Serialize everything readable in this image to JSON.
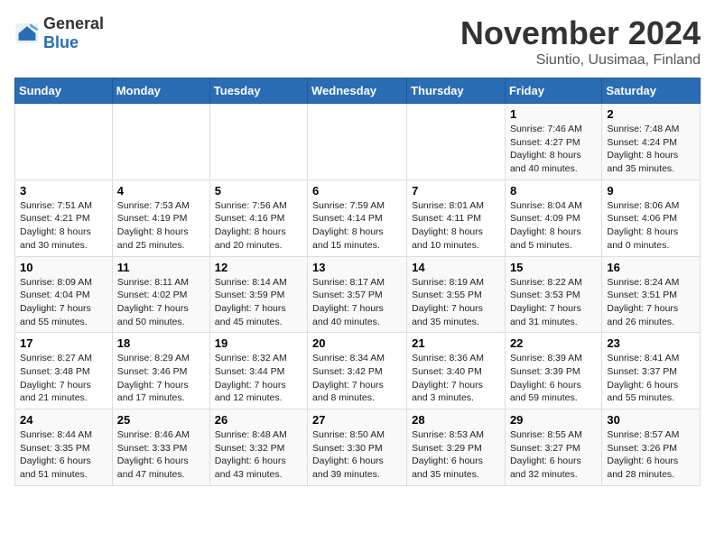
{
  "header": {
    "logo_general": "General",
    "logo_blue": "Blue",
    "month_title": "November 2024",
    "location": "Siuntio, Uusimaa, Finland"
  },
  "weekdays": [
    "Sunday",
    "Monday",
    "Tuesday",
    "Wednesday",
    "Thursday",
    "Friday",
    "Saturday"
  ],
  "weeks": [
    [
      {
        "day": "",
        "info": ""
      },
      {
        "day": "",
        "info": ""
      },
      {
        "day": "",
        "info": ""
      },
      {
        "day": "",
        "info": ""
      },
      {
        "day": "",
        "info": ""
      },
      {
        "day": "1",
        "info": "Sunrise: 7:46 AM\nSunset: 4:27 PM\nDaylight: 8 hours and 40 minutes."
      },
      {
        "day": "2",
        "info": "Sunrise: 7:48 AM\nSunset: 4:24 PM\nDaylight: 8 hours and 35 minutes."
      }
    ],
    [
      {
        "day": "3",
        "info": "Sunrise: 7:51 AM\nSunset: 4:21 PM\nDaylight: 8 hours and 30 minutes."
      },
      {
        "day": "4",
        "info": "Sunrise: 7:53 AM\nSunset: 4:19 PM\nDaylight: 8 hours and 25 minutes."
      },
      {
        "day": "5",
        "info": "Sunrise: 7:56 AM\nSunset: 4:16 PM\nDaylight: 8 hours and 20 minutes."
      },
      {
        "day": "6",
        "info": "Sunrise: 7:59 AM\nSunset: 4:14 PM\nDaylight: 8 hours and 15 minutes."
      },
      {
        "day": "7",
        "info": "Sunrise: 8:01 AM\nSunset: 4:11 PM\nDaylight: 8 hours and 10 minutes."
      },
      {
        "day": "8",
        "info": "Sunrise: 8:04 AM\nSunset: 4:09 PM\nDaylight: 8 hours and 5 minutes."
      },
      {
        "day": "9",
        "info": "Sunrise: 8:06 AM\nSunset: 4:06 PM\nDaylight: 8 hours and 0 minutes."
      }
    ],
    [
      {
        "day": "10",
        "info": "Sunrise: 8:09 AM\nSunset: 4:04 PM\nDaylight: 7 hours and 55 minutes."
      },
      {
        "day": "11",
        "info": "Sunrise: 8:11 AM\nSunset: 4:02 PM\nDaylight: 7 hours and 50 minutes."
      },
      {
        "day": "12",
        "info": "Sunrise: 8:14 AM\nSunset: 3:59 PM\nDaylight: 7 hours and 45 minutes."
      },
      {
        "day": "13",
        "info": "Sunrise: 8:17 AM\nSunset: 3:57 PM\nDaylight: 7 hours and 40 minutes."
      },
      {
        "day": "14",
        "info": "Sunrise: 8:19 AM\nSunset: 3:55 PM\nDaylight: 7 hours and 35 minutes."
      },
      {
        "day": "15",
        "info": "Sunrise: 8:22 AM\nSunset: 3:53 PM\nDaylight: 7 hours and 31 minutes."
      },
      {
        "day": "16",
        "info": "Sunrise: 8:24 AM\nSunset: 3:51 PM\nDaylight: 7 hours and 26 minutes."
      }
    ],
    [
      {
        "day": "17",
        "info": "Sunrise: 8:27 AM\nSunset: 3:48 PM\nDaylight: 7 hours and 21 minutes."
      },
      {
        "day": "18",
        "info": "Sunrise: 8:29 AM\nSunset: 3:46 PM\nDaylight: 7 hours and 17 minutes."
      },
      {
        "day": "19",
        "info": "Sunrise: 8:32 AM\nSunset: 3:44 PM\nDaylight: 7 hours and 12 minutes."
      },
      {
        "day": "20",
        "info": "Sunrise: 8:34 AM\nSunset: 3:42 PM\nDaylight: 7 hours and 8 minutes."
      },
      {
        "day": "21",
        "info": "Sunrise: 8:36 AM\nSunset: 3:40 PM\nDaylight: 7 hours and 3 minutes."
      },
      {
        "day": "22",
        "info": "Sunrise: 8:39 AM\nSunset: 3:39 PM\nDaylight: 6 hours and 59 minutes."
      },
      {
        "day": "23",
        "info": "Sunrise: 8:41 AM\nSunset: 3:37 PM\nDaylight: 6 hours and 55 minutes."
      }
    ],
    [
      {
        "day": "24",
        "info": "Sunrise: 8:44 AM\nSunset: 3:35 PM\nDaylight: 6 hours and 51 minutes."
      },
      {
        "day": "25",
        "info": "Sunrise: 8:46 AM\nSunset: 3:33 PM\nDaylight: 6 hours and 47 minutes."
      },
      {
        "day": "26",
        "info": "Sunrise: 8:48 AM\nSunset: 3:32 PM\nDaylight: 6 hours and 43 minutes."
      },
      {
        "day": "27",
        "info": "Sunrise: 8:50 AM\nSunset: 3:30 PM\nDaylight: 6 hours and 39 minutes."
      },
      {
        "day": "28",
        "info": "Sunrise: 8:53 AM\nSunset: 3:29 PM\nDaylight: 6 hours and 35 minutes."
      },
      {
        "day": "29",
        "info": "Sunrise: 8:55 AM\nSunset: 3:27 PM\nDaylight: 6 hours and 32 minutes."
      },
      {
        "day": "30",
        "info": "Sunrise: 8:57 AM\nSunset: 3:26 PM\nDaylight: 6 hours and 28 minutes."
      }
    ]
  ]
}
